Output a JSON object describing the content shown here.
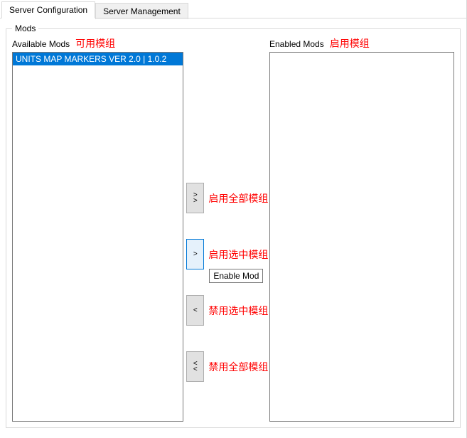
{
  "tabs": {
    "configuration": "Server Configuration",
    "management": "Server Management"
  },
  "fieldset": {
    "title": "Mods"
  },
  "available": {
    "label": "Available Mods",
    "annotation": "可用模组",
    "items": [
      "UNITS MAP MARKERS VER 2.0 | 1.0.2"
    ]
  },
  "enabled": {
    "label": "Enabled Mods",
    "annotation": "启用模组",
    "items": []
  },
  "buttons": {
    "enable_all": {
      "glyph1": ">",
      "glyph2": ">",
      "annotation": "启用全部模组"
    },
    "enable_one": {
      "glyph1": ">",
      "annotation": "启用选中模组",
      "tooltip": "Enable Mod"
    },
    "disable_one": {
      "glyph1": "<",
      "annotation": "禁用选中模组"
    },
    "disable_all": {
      "glyph1": "<",
      "glyph2": "<",
      "annotation": "禁用全部模组"
    }
  }
}
